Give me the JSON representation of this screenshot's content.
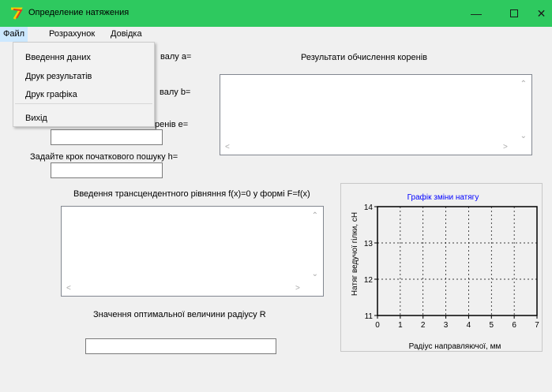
{
  "window": {
    "title": "Определение натяжения"
  },
  "menu": {
    "file": "Файл",
    "calc": "Розрахунок",
    "help": "Довідка"
  },
  "file_menu": {
    "items": [
      "Введення даних",
      "Друк результатів",
      "Друк графіка",
      "Вихід"
    ]
  },
  "form": {
    "a_label_visible": "валу  a=",
    "b_label_visible": "валу b=",
    "e_label_visible": "ренів e=",
    "h_label": "Задайте крок початкового пошуку h=",
    "results_title": "Результати обчислення коренів",
    "equation_label": "Введення трансцендентного рівняння f(x)=0  у формі F=f(x)",
    "optimal_label": "Значення оптимальної величини радіусу R",
    "e_value": "",
    "h_value": "",
    "r_value": ""
  },
  "chart_data": {
    "type": "line",
    "title": "Графік зміни натягу",
    "xlabel": "Радіус направляючої, мм",
    "ylabel": "Натяг ведучої гілки, сН",
    "xlim": [
      0,
      7
    ],
    "ylim": [
      11,
      14
    ],
    "x_ticks": [
      0,
      1,
      2,
      3,
      4,
      5,
      6,
      7
    ],
    "y_ticks": [
      11,
      12,
      13,
      14
    ],
    "grid": true,
    "series": [],
    "colors": {
      "title": "#0000ff",
      "axis": "#000000",
      "grid": "#000000"
    }
  }
}
